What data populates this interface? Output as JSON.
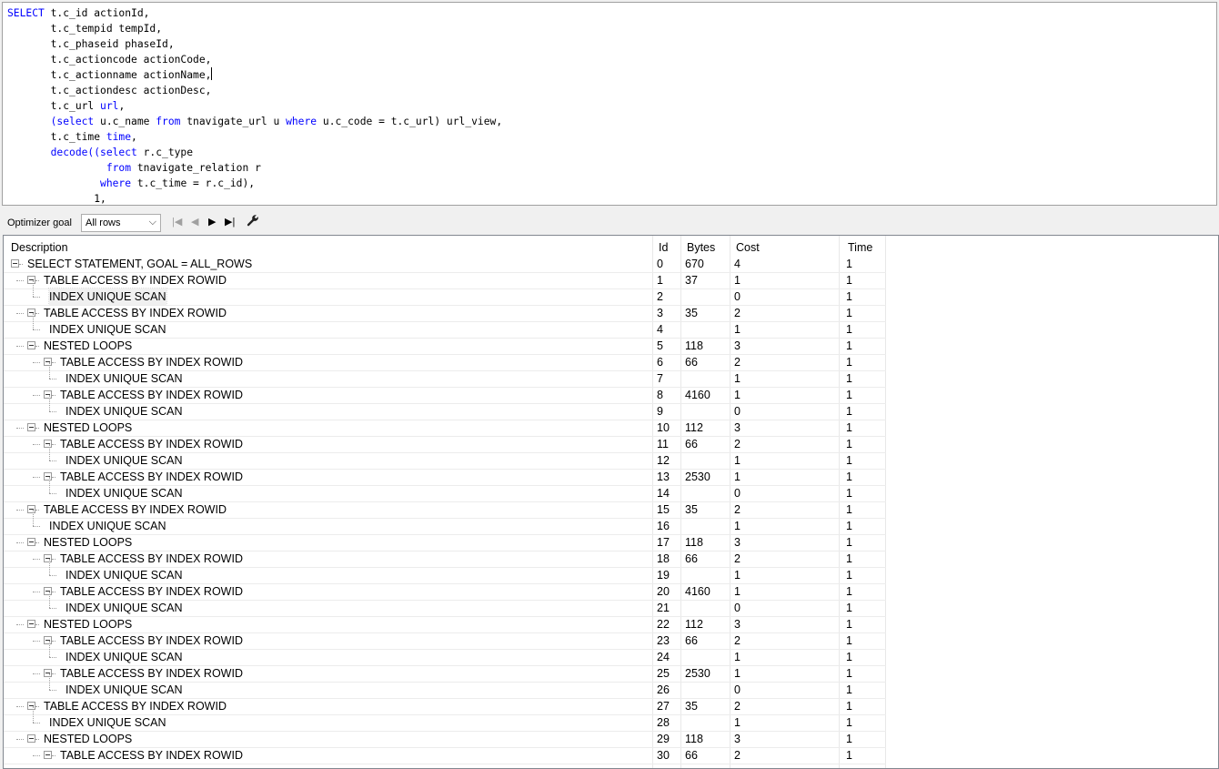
{
  "editor": {
    "lines": [
      [
        {
          "t": "SELECT",
          "k": true
        },
        {
          "t": " t.c_id actionId,"
        }
      ],
      [
        {
          "t": "       t.c_tempid tempId,"
        }
      ],
      [
        {
          "t": "       t.c_phaseid phaseId,"
        }
      ],
      [
        {
          "t": "       t.c_actioncode actionCode,"
        }
      ],
      [
        {
          "t": "       t.c_actionname actionName,"
        },
        {
          "caret": true
        }
      ],
      [
        {
          "t": "       t.c_actiondesc actionDesc,"
        }
      ],
      [
        {
          "t": "       t.c_url "
        },
        {
          "t": "url",
          "k": true
        },
        {
          "t": ","
        }
      ],
      [
        {
          "t": "       "
        },
        {
          "t": "(select",
          "k": true
        },
        {
          "t": " u.c_name "
        },
        {
          "t": "from",
          "k": true
        },
        {
          "t": " tnavigate_url u "
        },
        {
          "t": "where",
          "k": true
        },
        {
          "t": " u.c_code = t.c_url) url_view,"
        }
      ],
      [
        {
          "t": "       t.c_time "
        },
        {
          "t": "time",
          "k": true
        },
        {
          "t": ","
        }
      ],
      [
        {
          "t": "       "
        },
        {
          "t": "decode((select",
          "k": true
        },
        {
          "t": " r.c_type"
        }
      ],
      [
        {
          "t": "                "
        },
        {
          "t": "from",
          "k": true
        },
        {
          "t": " tnavigate_relation r"
        }
      ],
      [
        {
          "t": "               "
        },
        {
          "t": "where",
          "k": true
        },
        {
          "t": " t.c_time = r.c_id),"
        }
      ],
      [
        {
          "t": "              1,"
        }
      ]
    ]
  },
  "toolbar": {
    "optimizer_label": "Optimizer goal",
    "goal_value": "All rows",
    "first_icon": "|◀",
    "prev_icon": "◀",
    "next_icon": "▶",
    "last_icon": "▶|",
    "wrench_icon": "wrench-icon"
  },
  "grid": {
    "headers": {
      "description": "Description",
      "id": "Id",
      "bytes": "Bytes",
      "cost": "Cost",
      "time": "Time"
    },
    "rows": [
      {
        "d": "SELECT STATEMENT, GOAL = ALL_ROWS",
        "lvl": 0,
        "exp": true,
        "id": "0",
        "bytes": "670",
        "cost": "4",
        "time": "1"
      },
      {
        "d": "TABLE ACCESS BY INDEX ROWID",
        "lvl": 1,
        "exp": true,
        "id": "1",
        "bytes": "37",
        "cost": "1",
        "time": "1"
      },
      {
        "d": "INDEX UNIQUE SCAN",
        "lvl": 2,
        "exp": false,
        "id": "2",
        "bytes": "",
        "cost": "0",
        "time": "1",
        "sel": true
      },
      {
        "d": "TABLE ACCESS BY INDEX ROWID",
        "lvl": 1,
        "exp": true,
        "id": "3",
        "bytes": "35",
        "cost": "2",
        "time": "1"
      },
      {
        "d": "INDEX UNIQUE SCAN",
        "lvl": 2,
        "exp": false,
        "id": "4",
        "bytes": "",
        "cost": "1",
        "time": "1"
      },
      {
        "d": "NESTED LOOPS",
        "lvl": 1,
        "exp": true,
        "id": "5",
        "bytes": "118",
        "cost": "3",
        "time": "1"
      },
      {
        "d": "TABLE ACCESS BY INDEX ROWID",
        "lvl": 2,
        "exp": true,
        "id": "6",
        "bytes": "66",
        "cost": "2",
        "time": "1"
      },
      {
        "d": "INDEX UNIQUE SCAN",
        "lvl": 3,
        "exp": false,
        "id": "7",
        "bytes": "",
        "cost": "1",
        "time": "1"
      },
      {
        "d": "TABLE ACCESS BY INDEX ROWID",
        "lvl": 2,
        "exp": true,
        "id": "8",
        "bytes": "4160",
        "cost": "1",
        "time": "1"
      },
      {
        "d": "INDEX UNIQUE SCAN",
        "lvl": 3,
        "exp": false,
        "id": "9",
        "bytes": "",
        "cost": "0",
        "time": "1"
      },
      {
        "d": "NESTED LOOPS",
        "lvl": 1,
        "exp": true,
        "id": "10",
        "bytes": "112",
        "cost": "3",
        "time": "1"
      },
      {
        "d": "TABLE ACCESS BY INDEX ROWID",
        "lvl": 2,
        "exp": true,
        "id": "11",
        "bytes": "66",
        "cost": "2",
        "time": "1"
      },
      {
        "d": "INDEX UNIQUE SCAN",
        "lvl": 3,
        "exp": false,
        "id": "12",
        "bytes": "",
        "cost": "1",
        "time": "1"
      },
      {
        "d": "TABLE ACCESS BY INDEX ROWID",
        "lvl": 2,
        "exp": true,
        "id": "13",
        "bytes": "2530",
        "cost": "1",
        "time": "1"
      },
      {
        "d": "INDEX UNIQUE SCAN",
        "lvl": 3,
        "exp": false,
        "id": "14",
        "bytes": "",
        "cost": "0",
        "time": "1"
      },
      {
        "d": "TABLE ACCESS BY INDEX ROWID",
        "lvl": 1,
        "exp": true,
        "id": "15",
        "bytes": "35",
        "cost": "2",
        "time": "1"
      },
      {
        "d": "INDEX UNIQUE SCAN",
        "lvl": 2,
        "exp": false,
        "id": "16",
        "bytes": "",
        "cost": "1",
        "time": "1"
      },
      {
        "d": "NESTED LOOPS",
        "lvl": 1,
        "exp": true,
        "id": "17",
        "bytes": "118",
        "cost": "3",
        "time": "1"
      },
      {
        "d": "TABLE ACCESS BY INDEX ROWID",
        "lvl": 2,
        "exp": true,
        "id": "18",
        "bytes": "66",
        "cost": "2",
        "time": "1"
      },
      {
        "d": "INDEX UNIQUE SCAN",
        "lvl": 3,
        "exp": false,
        "id": "19",
        "bytes": "",
        "cost": "1",
        "time": "1"
      },
      {
        "d": "TABLE ACCESS BY INDEX ROWID",
        "lvl": 2,
        "exp": true,
        "id": "20",
        "bytes": "4160",
        "cost": "1",
        "time": "1"
      },
      {
        "d": "INDEX UNIQUE SCAN",
        "lvl": 3,
        "exp": false,
        "id": "21",
        "bytes": "",
        "cost": "0",
        "time": "1"
      },
      {
        "d": "NESTED LOOPS",
        "lvl": 1,
        "exp": true,
        "id": "22",
        "bytes": "112",
        "cost": "3",
        "time": "1"
      },
      {
        "d": "TABLE ACCESS BY INDEX ROWID",
        "lvl": 2,
        "exp": true,
        "id": "23",
        "bytes": "66",
        "cost": "2",
        "time": "1"
      },
      {
        "d": "INDEX UNIQUE SCAN",
        "lvl": 3,
        "exp": false,
        "id": "24",
        "bytes": "",
        "cost": "1",
        "time": "1"
      },
      {
        "d": "TABLE ACCESS BY INDEX ROWID",
        "lvl": 2,
        "exp": true,
        "id": "25",
        "bytes": "2530",
        "cost": "1",
        "time": "1"
      },
      {
        "d": "INDEX UNIQUE SCAN",
        "lvl": 3,
        "exp": false,
        "id": "26",
        "bytes": "",
        "cost": "0",
        "time": "1"
      },
      {
        "d": "TABLE ACCESS BY INDEX ROWID",
        "lvl": 1,
        "exp": true,
        "id": "27",
        "bytes": "35",
        "cost": "2",
        "time": "1"
      },
      {
        "d": "INDEX UNIQUE SCAN",
        "lvl": 2,
        "exp": false,
        "id": "28",
        "bytes": "",
        "cost": "1",
        "time": "1"
      },
      {
        "d": "NESTED LOOPS",
        "lvl": 1,
        "exp": true,
        "id": "29",
        "bytes": "118",
        "cost": "3",
        "time": "1"
      },
      {
        "d": "TABLE ACCESS BY INDEX ROWID",
        "lvl": 2,
        "exp": true,
        "id": "30",
        "bytes": "66",
        "cost": "2",
        "time": "1"
      }
    ]
  }
}
